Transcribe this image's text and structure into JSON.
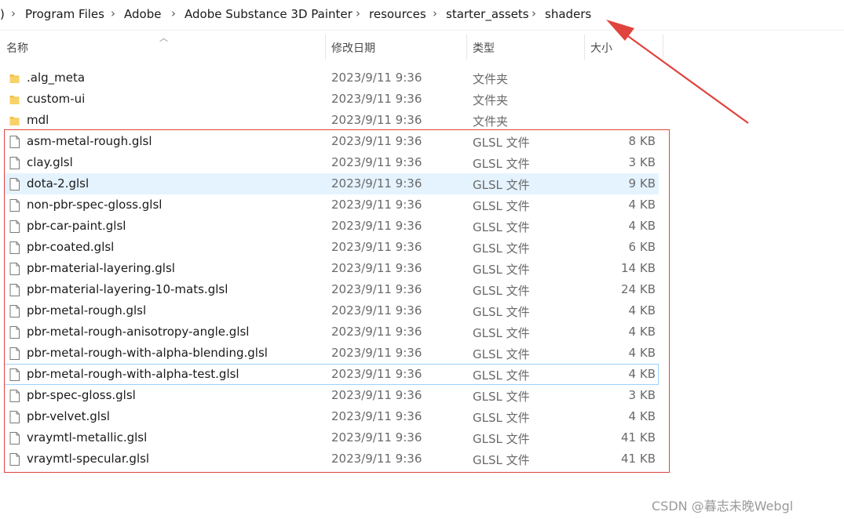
{
  "breadcrumb": {
    "lead": ")",
    "items": [
      "Program Files",
      "Adobe",
      "Adobe Substance 3D Painter",
      "resources",
      "starter_assets",
      "shaders"
    ]
  },
  "columns": {
    "name": "名称",
    "date": "修改日期",
    "type": "类型",
    "size": "大小"
  },
  "rows": [
    {
      "name": ".alg_meta",
      "date": "2023/9/11 9:36",
      "type": "文件夹",
      "size": "",
      "kind": "folder"
    },
    {
      "name": "custom-ui",
      "date": "2023/9/11 9:36",
      "type": "文件夹",
      "size": "",
      "kind": "folder"
    },
    {
      "name": "mdl",
      "date": "2023/9/11 9:36",
      "type": "文件夹",
      "size": "",
      "kind": "folder"
    },
    {
      "name": "asm-metal-rough.glsl",
      "date": "2023/9/11 9:36",
      "type": "GLSL 文件",
      "size": "8 KB",
      "kind": "file"
    },
    {
      "name": "clay.glsl",
      "date": "2023/9/11 9:36",
      "type": "GLSL 文件",
      "size": "3 KB",
      "kind": "file"
    },
    {
      "name": "dota-2.glsl",
      "date": "2023/9/11 9:36",
      "type": "GLSL 文件",
      "size": "9 KB",
      "kind": "file",
      "state": "selected"
    },
    {
      "name": "non-pbr-spec-gloss.glsl",
      "date": "2023/9/11 9:36",
      "type": "GLSL 文件",
      "size": "4 KB",
      "kind": "file"
    },
    {
      "name": "pbr-car-paint.glsl",
      "date": "2023/9/11 9:36",
      "type": "GLSL 文件",
      "size": "4 KB",
      "kind": "file"
    },
    {
      "name": "pbr-coated.glsl",
      "date": "2023/9/11 9:36",
      "type": "GLSL 文件",
      "size": "6 KB",
      "kind": "file"
    },
    {
      "name": "pbr-material-layering.glsl",
      "date": "2023/9/11 9:36",
      "type": "GLSL 文件",
      "size": "14 KB",
      "kind": "file"
    },
    {
      "name": "pbr-material-layering-10-mats.glsl",
      "date": "2023/9/11 9:36",
      "type": "GLSL 文件",
      "size": "24 KB",
      "kind": "file"
    },
    {
      "name": "pbr-metal-rough.glsl",
      "date": "2023/9/11 9:36",
      "type": "GLSL 文件",
      "size": "4 KB",
      "kind": "file"
    },
    {
      "name": "pbr-metal-rough-anisotropy-angle.glsl",
      "date": "2023/9/11 9:36",
      "type": "GLSL 文件",
      "size": "4 KB",
      "kind": "file"
    },
    {
      "name": "pbr-metal-rough-with-alpha-blending.glsl",
      "date": "2023/9/11 9:36",
      "type": "GLSL 文件",
      "size": "4 KB",
      "kind": "file"
    },
    {
      "name": "pbr-metal-rough-with-alpha-test.glsl",
      "date": "2023/9/11 9:36",
      "type": "GLSL 文件",
      "size": "4 KB",
      "kind": "file",
      "state": "focused"
    },
    {
      "name": "pbr-spec-gloss.glsl",
      "date": "2023/9/11 9:36",
      "type": "GLSL 文件",
      "size": "3 KB",
      "kind": "file"
    },
    {
      "name": "pbr-velvet.glsl",
      "date": "2023/9/11 9:36",
      "type": "GLSL 文件",
      "size": "4 KB",
      "kind": "file"
    },
    {
      "name": "vraymtl-metallic.glsl",
      "date": "2023/9/11 9:36",
      "type": "GLSL 文件",
      "size": "41 KB",
      "kind": "file"
    },
    {
      "name": "vraymtl-specular.glsl",
      "date": "2023/9/11 9:36",
      "type": "GLSL 文件",
      "size": "41 KB",
      "kind": "file"
    }
  ],
  "icons": {
    "folder": "folder-icon",
    "file": "file-icon",
    "separator": "chevron-right-icon",
    "sort": "sort-up-icon"
  },
  "colors": {
    "folder": "#f4c042",
    "annotation": "#e0443e",
    "selected": "#e5f3ff",
    "focus": "#99d1ff"
  },
  "watermark": "CSDN @暮志未晚Webgl"
}
